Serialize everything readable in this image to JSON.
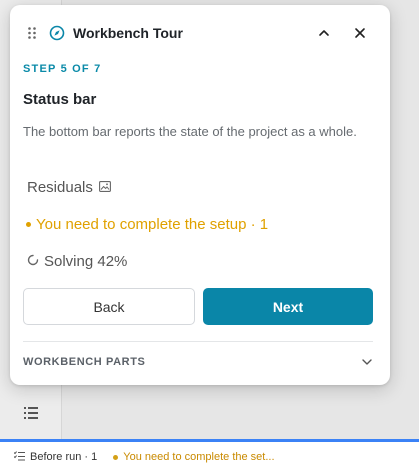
{
  "tour": {
    "title": "Workbench Tour",
    "step_label": "STEP 5 OF 7",
    "step_title": "Status bar",
    "description": "The bottom bar reports the state of the project as a whole.",
    "demo": {
      "residuals": "Residuals",
      "warning": "You need to complete the setup · 1",
      "solving": "Solving 42%"
    },
    "back_label": "Back",
    "next_label": "Next",
    "parts_label": "WORKBENCH PARTS"
  },
  "status_bar": {
    "before_run": "Before run · 1",
    "warning": "You need to complete the set..."
  },
  "icons": {
    "drag": "drag-handle-icon",
    "compass": "compass-icon",
    "collapse": "chevron-up-icon",
    "close": "close-icon",
    "image": "image-icon",
    "spinner": "spinner-icon",
    "chevron_down": "chevron-down-icon",
    "list": "list-icon"
  },
  "colors": {
    "accent": "#0a86a8",
    "warning": "#e0a100",
    "status_accent": "#3b82f6"
  }
}
